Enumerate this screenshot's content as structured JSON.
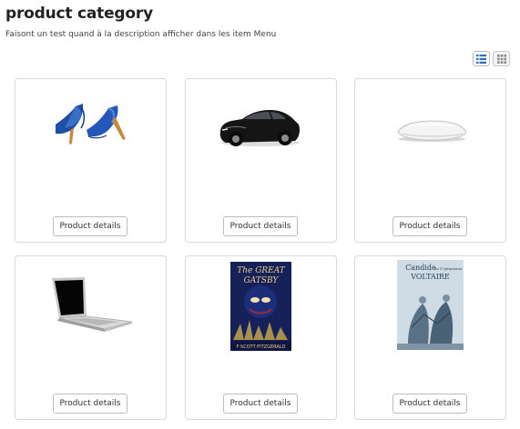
{
  "header": {
    "title": "product category",
    "description": "Faisont un test quand à la description afficher dans les item Menu"
  },
  "view_toggle": {
    "list_icon": "list-icon",
    "grid_icon": "grid-icon",
    "active": "list",
    "accent": "#2f6db5"
  },
  "products": [
    {
      "image": "blue-high-heel-shoes",
      "button_label": "Product details"
    },
    {
      "image": "black-sports-car",
      "button_label": "Product details"
    },
    {
      "image": "white-computer-mouse",
      "button_label": "Product details"
    },
    {
      "image": "silver-laptop",
      "button_label": "Product details"
    },
    {
      "image": "book-cover-the-great-gatsby",
      "button_label": "Product details",
      "cover_text": {
        "title_top": "The GREAT",
        "title_bottom": "GATSBY",
        "author": "F·SCOTT·FITZGERALD"
      }
    },
    {
      "image": "book-cover-candide",
      "button_label": "Product details",
      "cover_text": {
        "title": "Candide",
        "subtitle": "ou l'Optimisme",
        "author": "VOLTAIRE"
      }
    }
  ]
}
